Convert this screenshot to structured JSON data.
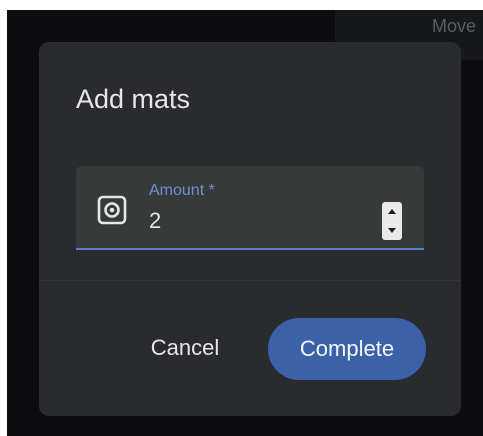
{
  "background": {
    "panel_label": "Move"
  },
  "dialog": {
    "title": "Add mats",
    "amount_field": {
      "label": "Amount *",
      "value": "2",
      "icon": "target-square-icon"
    },
    "actions": {
      "cancel_label": "Cancel",
      "complete_label": "Complete"
    }
  },
  "colors": {
    "accent": "#3b62a8",
    "label_accent": "#6f8fd8",
    "dialog_bg": "#2a2b2e",
    "field_bg": "#363a39",
    "backdrop": "#0d0d0f"
  }
}
